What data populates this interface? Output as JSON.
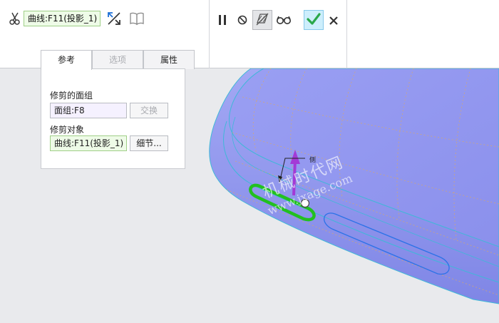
{
  "toolbar": {
    "reference_curve": "曲线:F11(投影_1)",
    "icons": [
      "scissors-icon",
      "flip-direction-icon",
      "open-book-icon",
      "pause-icon",
      "no-preview-icon",
      "geometry-preview-icon",
      "glasses-icon",
      "checkmark-icon",
      "close-icon"
    ],
    "accent_color": "#2aa84a"
  },
  "tabs": [
    {
      "label": "参考",
      "state": "active"
    },
    {
      "label": "选项",
      "state": "disabled"
    },
    {
      "label": "属性",
      "state": "normal"
    }
  ],
  "panel": {
    "trim_quilt_label": "修剪的面组",
    "trim_quilt_value": "面组:F8",
    "swap_button": "交换",
    "trim_object_label": "修剪对象",
    "trim_object_value": "曲线:F11(投影_1)",
    "details_button": "细节..."
  },
  "viewport": {
    "arrow_label": "侧",
    "model_color": "#8f94ee",
    "highlight_color": "#22c020"
  },
  "watermark": {
    "text": "机械时代网",
    "url": "www.jxage.com"
  }
}
